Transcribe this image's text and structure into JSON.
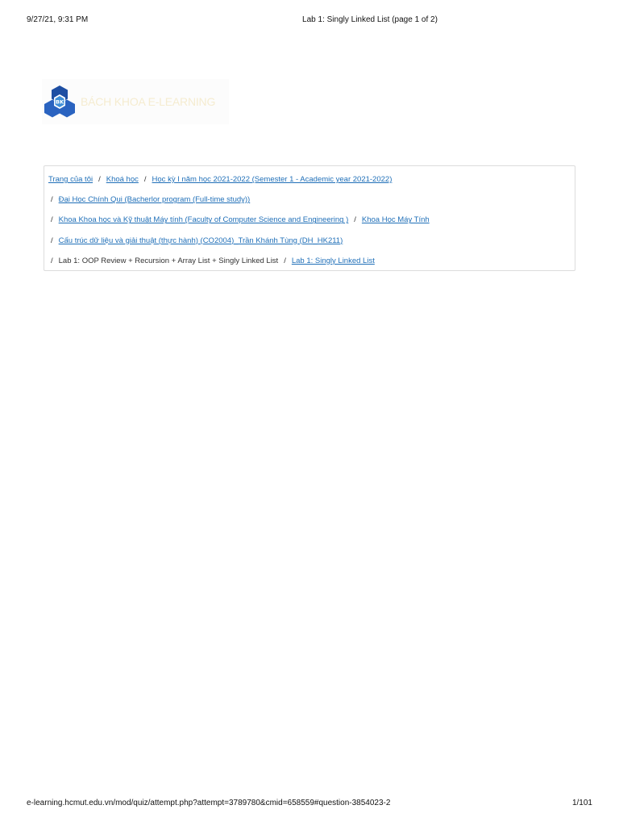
{
  "print_header": {
    "date": "9/27/21, 9:31 PM",
    "title": "Lab 1: Singly Linked List (page 1 of 2)"
  },
  "brand": {
    "logo_text": "BK",
    "name": "BÁCH KHOA E-LEARNING",
    "colors": {
      "logo_blue": "#1e4fa3",
      "logo_light": "#3f8fd8",
      "name_color": "#f5ecd0"
    }
  },
  "breadcrumb": {
    "separator": "/",
    "items": [
      {
        "label": "Trang của tôi",
        "link": true
      },
      {
        "label": "Khoá học",
        "link": true
      },
      {
        "label": "Học kỳ I năm học 2021-2022 (Semester 1 - Academic year 2021-2022)",
        "link": true
      },
      {
        "label": "Đại Học Chính Qui (Bacherlor program (Full-time study))",
        "link": true
      },
      {
        "label": "Khoa Khoa học và Kỹ thuật Máy tính (Faculty of Computer Science and Engineering )",
        "link": true
      },
      {
        "label": "Khoa Học Máy Tính",
        "link": true
      },
      {
        "label": "Cấu trúc dữ liệu và giải thuật (thực hành) (CO2004)_Trần Khánh Tùng (DH_HK211)",
        "link": true
      },
      {
        "label": "Lab 1: OOP Review + Recursion + Array List + Singly Linked List",
        "link": false
      },
      {
        "label": "Lab 1: Singly Linked List",
        "link": true
      }
    ],
    "colors": {
      "link": "#1f6fb8",
      "text": "#333333",
      "border": "#dcdcdc"
    }
  },
  "print_footer": {
    "url": "e-learning.hcmut.edu.vn/mod/quiz/attempt.php?attempt=3789780&cmid=658559#question-3854023-2",
    "page": "1/101"
  }
}
